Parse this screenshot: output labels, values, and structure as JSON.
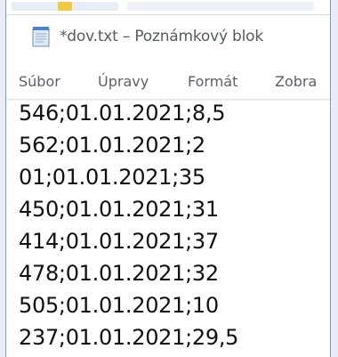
{
  "window": {
    "title": "*dov.txt – Poznámkový blok"
  },
  "menu": {
    "items": [
      "Súbor",
      "Úpravy",
      "Formát",
      "Zobra"
    ]
  },
  "editor": {
    "lines": [
      "546;01.01.2021;8,5",
      "562;01.01.2021;2",
      "01;01.01.2021;35",
      "450;01.01.2021;31",
      "414;01.01.2021;37",
      "478;01.01.2021;32",
      "505;01.01.2021;10",
      "237;01.01.2021;29,5"
    ]
  },
  "icons": {
    "app": "notepad-icon"
  },
  "colors": {
    "window_border": "#6f9ed8",
    "title_text": "#555b62",
    "menu_text": "#5b6168",
    "editor_text": "#101010"
  }
}
